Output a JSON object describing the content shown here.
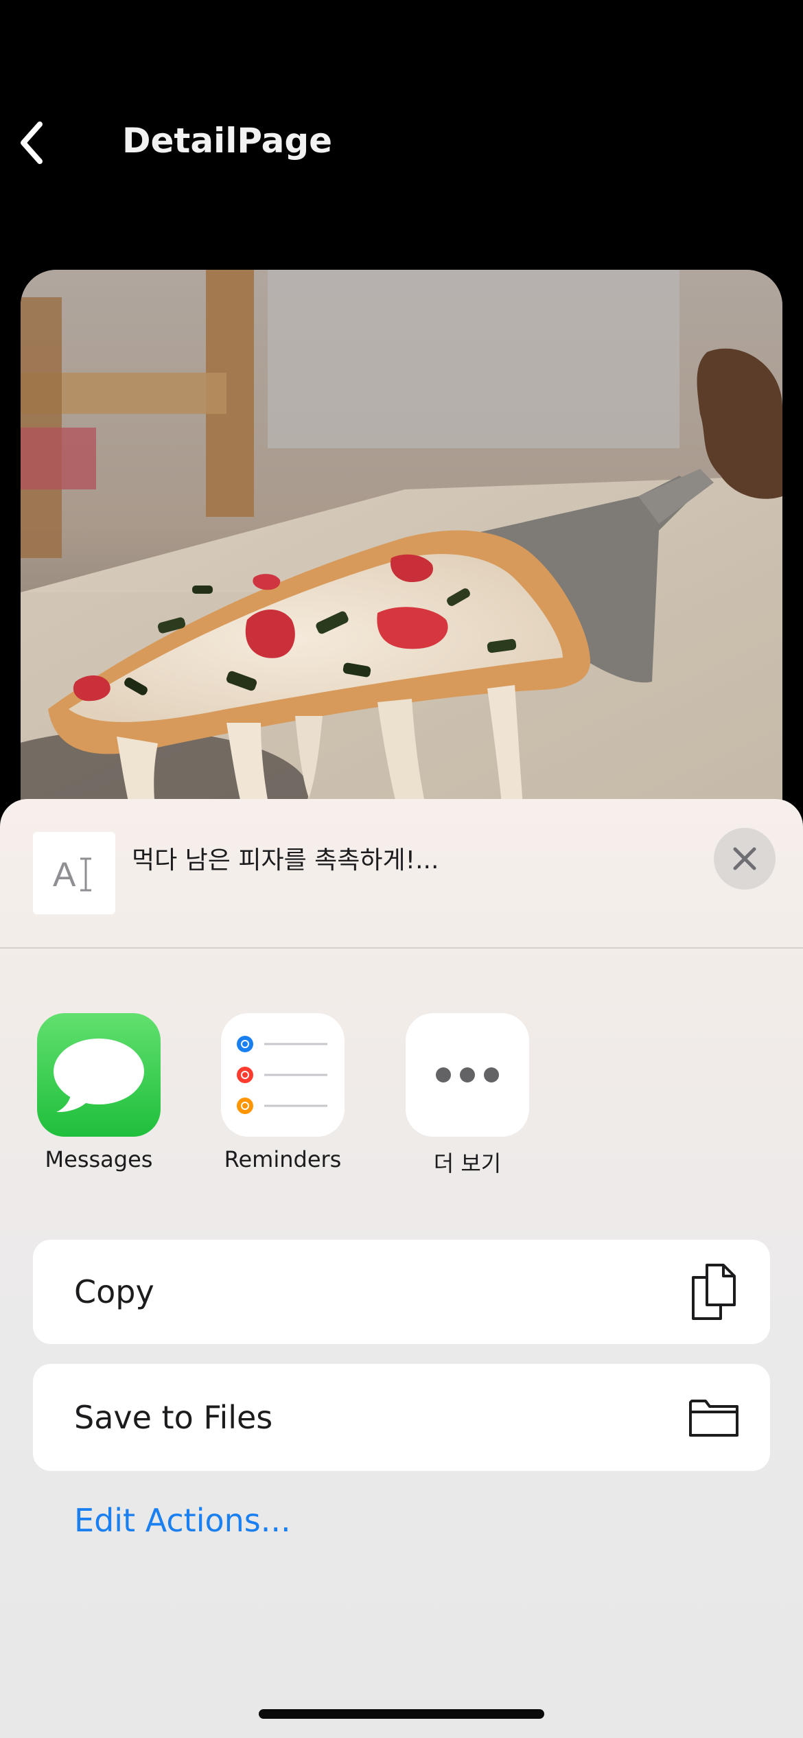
{
  "nav": {
    "title": "DetailPage",
    "back_icon": "chevron-left-icon"
  },
  "photo": {
    "subject": "pizza-slice-photo"
  },
  "share_sheet": {
    "preview_icon": "text-cursor-icon",
    "preview_glyph": "A",
    "preview_text": "먹다 남은 피자를 촉촉하게!...",
    "close_icon": "close-icon",
    "apps": [
      {
        "label": "Messages",
        "icon": "messages-icon",
        "color": "#34c759"
      },
      {
        "label": "Reminders",
        "icon": "reminders-icon",
        "color": "#ffffff"
      },
      {
        "label": "더 보기",
        "icon": "more-icon",
        "color": "#ffffff"
      }
    ],
    "actions": [
      {
        "label": "Copy",
        "icon": "copy-icon"
      },
      {
        "label": "Save to Files",
        "icon": "folder-icon"
      }
    ],
    "edit_actions_label": "Edit Actions...",
    "accent_color": "#1a7ff0"
  }
}
